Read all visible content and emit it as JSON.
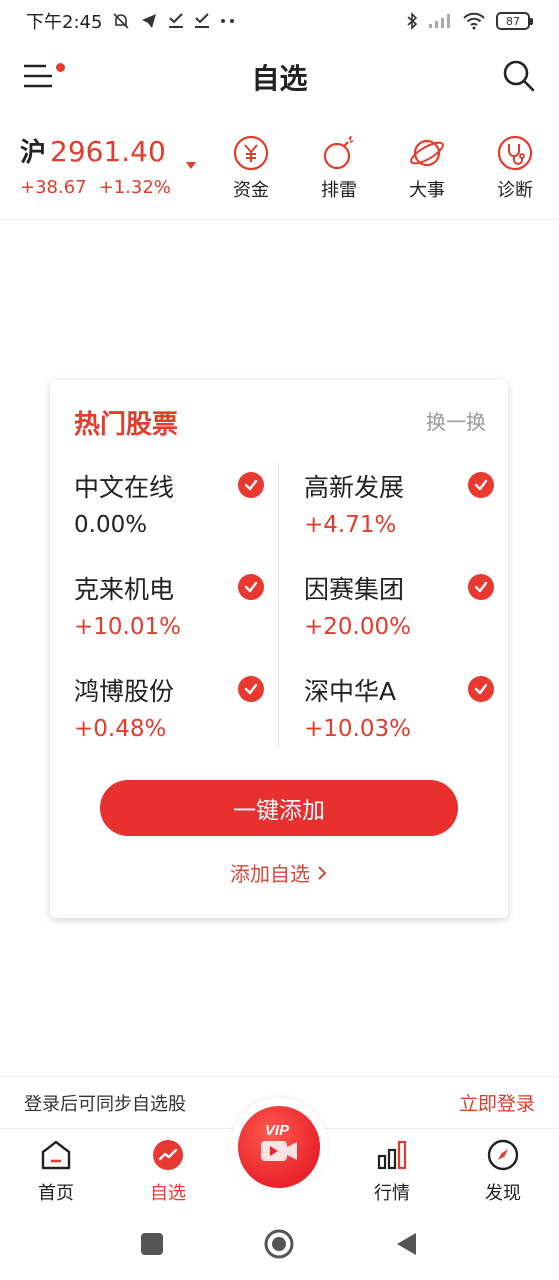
{
  "status_bar": {
    "time": "下午2:45",
    "battery": "87"
  },
  "header": {
    "title": "自选"
  },
  "index": {
    "name": "沪",
    "value": "2961.40",
    "change": "+38.67",
    "change_pct": "+1.32%"
  },
  "quick_actions": [
    {
      "label": "资金",
      "icon": "yuan-circle-icon"
    },
    {
      "label": "排雷",
      "icon": "bomb-icon"
    },
    {
      "label": "大事",
      "icon": "planet-icon"
    },
    {
      "label": "诊断",
      "icon": "stethoscope-icon"
    }
  ],
  "hot_stocks": {
    "title": "热门股票",
    "refresh_label": "换一换",
    "items": [
      {
        "name": "中文在线",
        "change": "0.00%"
      },
      {
        "name": "高新发展",
        "change": "+4.71%"
      },
      {
        "name": "克来机电",
        "change": "+10.01%"
      },
      {
        "name": "因赛集团",
        "change": "+20.00%"
      },
      {
        "name": "鸿博股份",
        "change": "+0.48%"
      },
      {
        "name": "深中华A",
        "change": "+10.03%"
      }
    ],
    "add_all_label": "一键添加",
    "add_watch_label": "添加自选"
  },
  "login_bar": {
    "hint": "登录后可同步自选股",
    "action": "立即登录"
  },
  "bottom_nav": [
    {
      "label": "首页",
      "icon": "home-icon"
    },
    {
      "label": "自选",
      "icon": "watchlist-icon"
    },
    {
      "label": "VIP",
      "icon": "vip-video-icon"
    },
    {
      "label": "行情",
      "icon": "market-bars-icon"
    },
    {
      "label": "发现",
      "icon": "compass-icon"
    }
  ],
  "colors": {
    "accent": "#e8382f",
    "rise": "#e23c2c"
  }
}
